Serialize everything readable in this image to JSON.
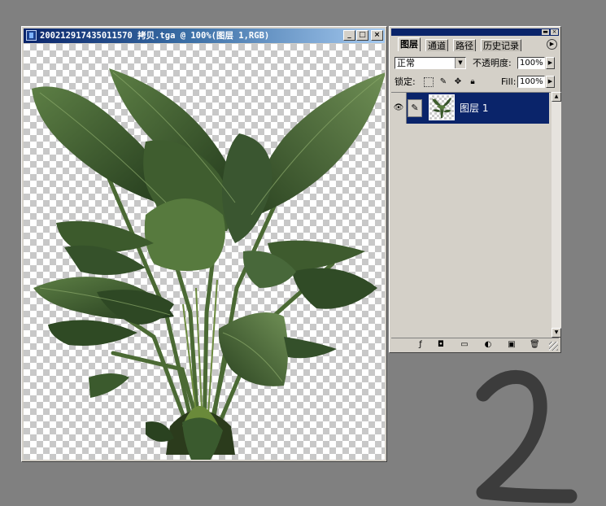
{
  "document": {
    "title": "200212917435011570 拷贝.tga @ 100%(图层 1,RGB)",
    "buttons": {
      "minimize": "_",
      "maximize": "□",
      "close": "×"
    }
  },
  "layers_panel": {
    "tabs": [
      {
        "label": "图层",
        "active": true
      },
      {
        "label": "通道",
        "active": false
      },
      {
        "label": "路径",
        "active": false
      },
      {
        "label": "历史记录",
        "active": false
      }
    ],
    "blend_mode": "正常",
    "opacity_label": "不透明度:",
    "opacity_value": "100%",
    "lock_label": "锁定:",
    "fill_label": "Fill:",
    "fill_value": "100%",
    "layers": [
      {
        "name": "图层 1",
        "visible": true,
        "selected": true
      }
    ],
    "footer_icons": [
      "layer-style-icon",
      "layer-mask-icon",
      "new-set-icon",
      "adjustment-layer-icon",
      "new-layer-icon",
      "trash-icon"
    ]
  },
  "annotation": {
    "text": "2",
    "color": "#3c3c3c"
  },
  "colors": {
    "desktop": "#808080",
    "titlebar_start": "#0a246a",
    "titlebar_end": "#a6caf0",
    "selection": "#0a246a",
    "chrome": "#d4d0c8",
    "leaf_dark": "#2f4a24",
    "leaf_mid": "#4d6b39"
  }
}
